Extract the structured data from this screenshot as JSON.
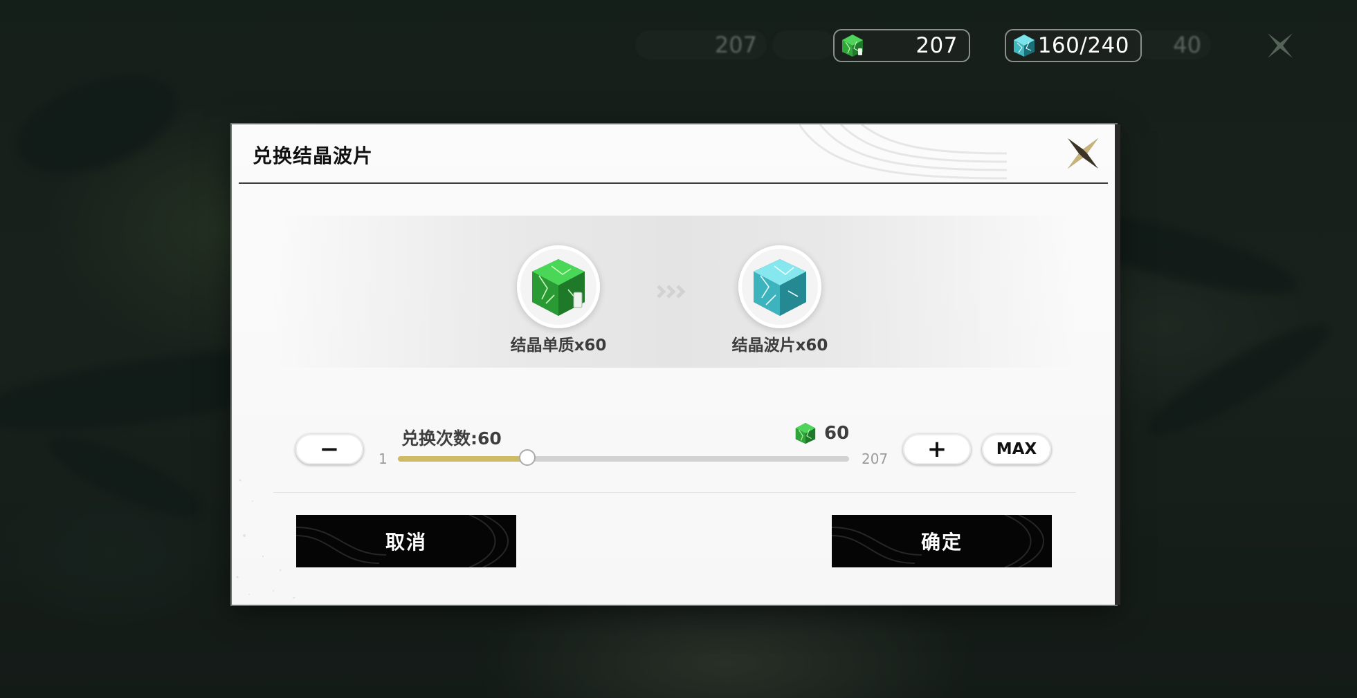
{
  "hud": {
    "ghost_left_value": "207",
    "ghost_right_value": "40",
    "crystal_monomer_count": "207",
    "crystal_wave_count": "160/240"
  },
  "dialog": {
    "title": "兑换结晶波片",
    "from_item": {
      "label": "结晶单质x60",
      "icon": "green-crystal-cube-icon"
    },
    "to_item": {
      "label": "结晶波片x60",
      "icon": "cyan-crystal-cube-icon"
    },
    "exchange_count_label": "兑换次数:60",
    "cost_value": "60",
    "slider": {
      "min_label": "1",
      "max_label": "207",
      "min": 1,
      "max": 207,
      "value": 60
    },
    "minus_label": "−",
    "plus_label": "+",
    "max_label": "MAX",
    "cancel_label": "取消",
    "confirm_label": "确定"
  },
  "colors": {
    "slider_fill": "#cfbb63",
    "green_crystal": "#2fa53a",
    "cyan_crystal": "#3fb8c2",
    "button_bg": "#050505"
  }
}
